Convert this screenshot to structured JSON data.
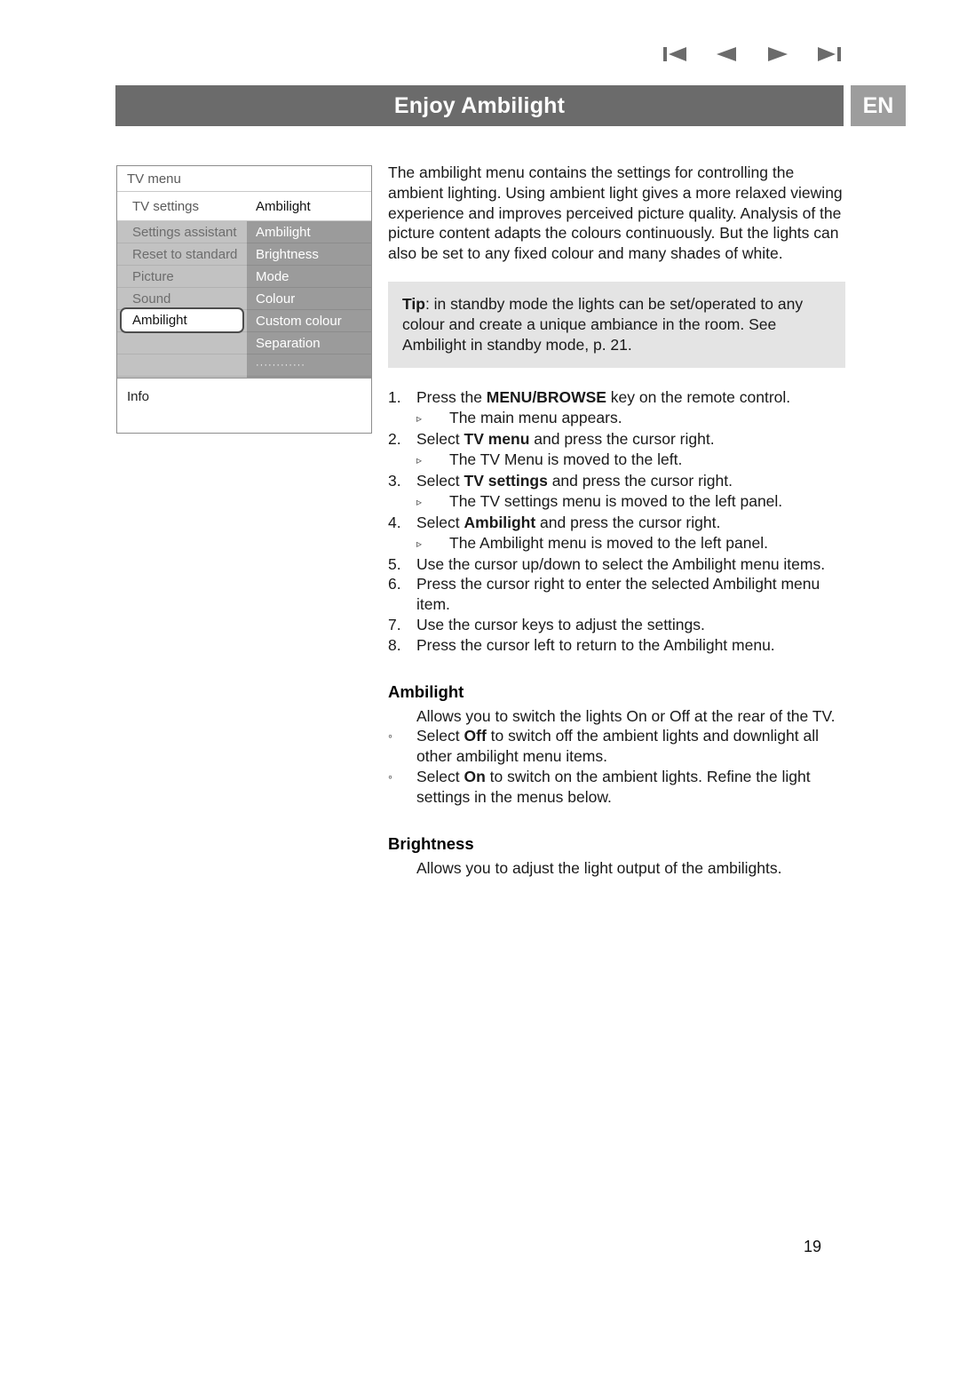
{
  "nav": {
    "buttons": [
      {
        "name": "skip-to-start",
        "label": "⏮"
      },
      {
        "name": "previous-page",
        "label": "◀"
      },
      {
        "name": "next-page",
        "label": "▶"
      },
      {
        "name": "skip-to-end",
        "label": "⏭"
      }
    ]
  },
  "header": {
    "title": "Enjoy Ambilight",
    "language_badge": "EN",
    "bar_color": "#6b6b6b",
    "badge_color": "#9d9d9d"
  },
  "tv_menu": {
    "title": "TV menu",
    "breadcrumb_left": "TV settings",
    "breadcrumb_right": "Ambilight",
    "left_column": [
      "Settings assistant",
      "Reset to standard",
      "Picture",
      "Sound",
      "Ambilight",
      "",
      ""
    ],
    "selected_left_item": "Ambilight",
    "right_column": [
      "Ambilight",
      "Brightness",
      "Mode",
      "Colour",
      "Custom colour",
      "Separation",
      "············"
    ],
    "footer": "Info",
    "left_bg": "#c2c2c2",
    "right_bg": "#9b9b9b"
  },
  "intro": {
    "paragraph": "The ambilight menu contains the settings for controlling the ambient lighting. Using ambient light gives a more relaxed viewing experience and improves perceived picture quality. Analysis of the picture content adapts the colours continuously. But the lights can also be set to any fixed colour and many shades of white."
  },
  "tip": {
    "label": "Tip",
    "text": ": in standby mode the lights can be set/operated to any colour and create a unique ambiance in the room.  See Ambilight in standby mode, p. 21.",
    "background": "#e4e4e4"
  },
  "steps": [
    {
      "num": "1.",
      "pre": "Press the ",
      "bold": "MENU/BROWSE",
      "post": " key on the remote control.",
      "sub": "The main menu appears."
    },
    {
      "num": "2.",
      "pre": "Select ",
      "bold": "TV menu",
      "post": " and press the cursor right.",
      "sub": "The TV Menu is moved to the left."
    },
    {
      "num": "3.",
      "pre": "Select ",
      "bold": "TV settings",
      "post": " and press the cursor right.",
      "sub": "The TV settings menu is moved to the left panel."
    },
    {
      "num": "4.",
      "pre": "Select ",
      "bold": "Ambilight",
      "post": " and press the cursor right.",
      "sub": "The Ambilight menu is moved to the left panel."
    },
    {
      "num": "5.",
      "pre": "Use the cursor up/down to select the Ambilight menu items.",
      "bold": "",
      "post": "",
      "sub": ""
    },
    {
      "num": "6.",
      "pre": "Press the cursor right to enter the selected Ambilight menu item.",
      "bold": "",
      "post": "",
      "sub": ""
    },
    {
      "num": "7.",
      "pre": "Use the cursor keys to adjust the settings.",
      "bold": "",
      "post": "",
      "sub": ""
    },
    {
      "num": "8.",
      "pre": "Press the cursor left to return to the Ambilight menu.",
      "bold": "",
      "post": "",
      "sub": ""
    }
  ],
  "substep_marker": "▹",
  "bullet_marker": "◦",
  "sections": [
    {
      "heading": "Ambilight",
      "para": "Allows you to switch the lights On or Off at the rear of the TV.",
      "bullets": [
        {
          "pre": "Select ",
          "bold": "Off",
          "post": " to switch off the ambient lights and downlight all other ambilight menu items."
        },
        {
          "pre": "Select ",
          "bold": "On",
          "post": " to switch on the ambient lights. Refine the light settings in the menus below."
        }
      ]
    },
    {
      "heading": "Brightness",
      "para": "Allows you to adjust the light output of the ambilights.",
      "bullets": []
    }
  ],
  "page_number": "19"
}
